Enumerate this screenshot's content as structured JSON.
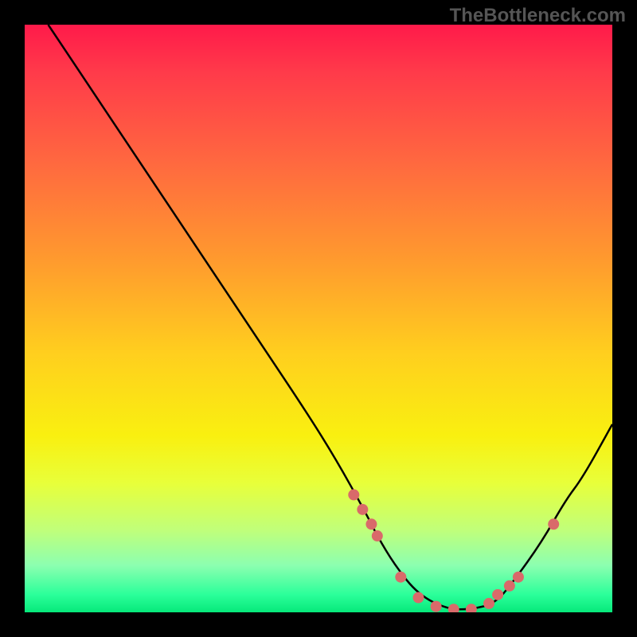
{
  "watermark": "TheBottleneck.com",
  "chart_data": {
    "type": "line",
    "title": "",
    "xlabel": "",
    "ylabel": "",
    "xlim": [
      0,
      100
    ],
    "ylim": [
      0,
      100
    ],
    "curve": {
      "name": "bottleneck-curve",
      "x": [
        4,
        10,
        20,
        30,
        40,
        48,
        53,
        58,
        60,
        63,
        67,
        72,
        76,
        80,
        83,
        88,
        92,
        95,
        100
      ],
      "y": [
        100,
        91,
        76,
        61,
        46,
        34,
        26,
        17,
        13,
        8,
        3,
        0.5,
        0.5,
        1.5,
        5,
        12,
        19,
        23,
        32
      ]
    },
    "markers": {
      "name": "highlight-points",
      "x": [
        56,
        57.5,
        59,
        60,
        64,
        67,
        70,
        73,
        76,
        79,
        80.5,
        82.5,
        84,
        90
      ],
      "y": [
        20,
        17.5,
        15,
        13,
        6,
        2.5,
        1,
        0.5,
        0.5,
        1.5,
        3,
        4.5,
        6,
        15
      ]
    },
    "gradient_stops": [
      {
        "pos": 0,
        "color": "#ff1a4a"
      },
      {
        "pos": 8,
        "color": "#ff3a4a"
      },
      {
        "pos": 24,
        "color": "#ff6a3f"
      },
      {
        "pos": 40,
        "color": "#ff9a2e"
      },
      {
        "pos": 56,
        "color": "#ffcf1e"
      },
      {
        "pos": 70,
        "color": "#f9f010"
      },
      {
        "pos": 78,
        "color": "#e8ff3a"
      },
      {
        "pos": 86,
        "color": "#c0ff7a"
      },
      {
        "pos": 92,
        "color": "#8cffb0"
      },
      {
        "pos": 97,
        "color": "#2bff9a"
      },
      {
        "pos": 100,
        "color": "#06e87a"
      }
    ],
    "marker_color": "#d96a6a",
    "curve_color": "#000000"
  }
}
